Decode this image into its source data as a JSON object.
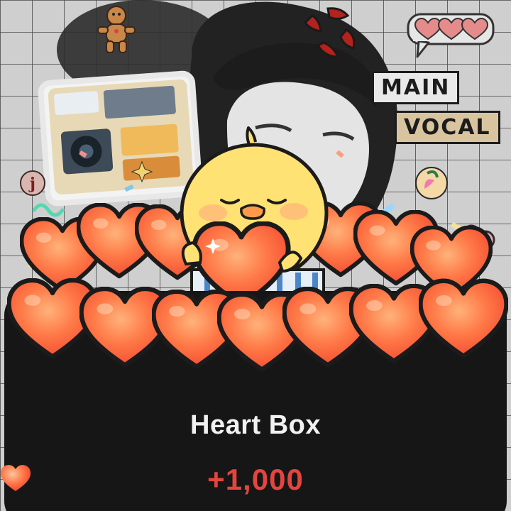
{
  "stickers": {
    "main_label": "MAIN",
    "vocal_label": "VOCAL"
  },
  "gift": {
    "title": "Heart Box",
    "reward_text": "+1,000",
    "reward_icon": "heart-icon"
  },
  "colors": {
    "panel_background": "#161616",
    "title_text": "#f1f1f1",
    "reward_text": "#e3453f",
    "heart_fill": "#ff6a3d",
    "chick_fill": "#ffe273"
  }
}
